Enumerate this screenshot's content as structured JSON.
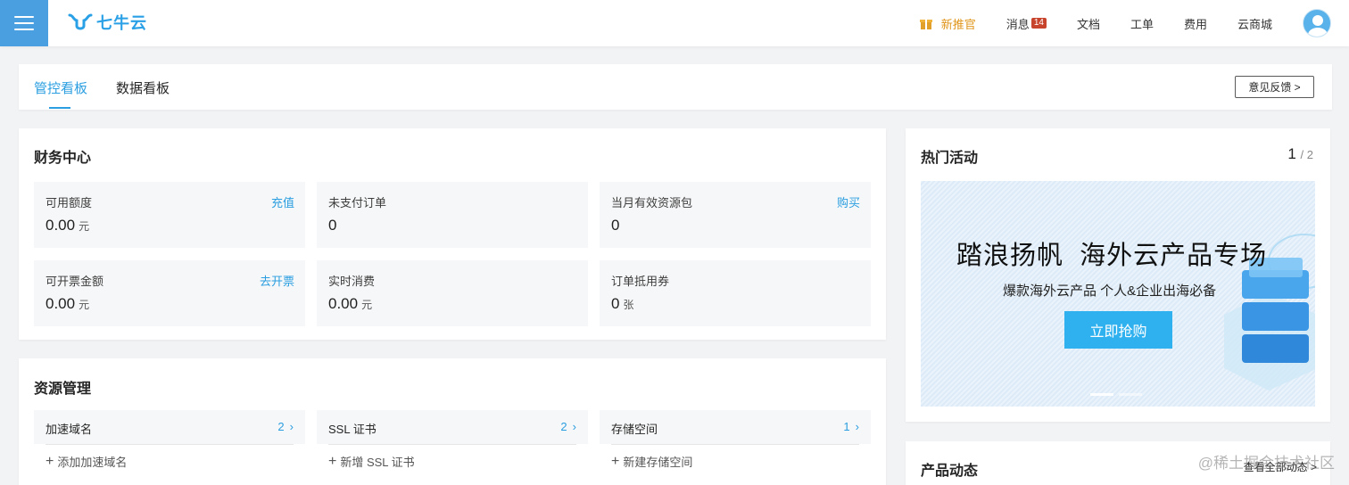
{
  "header": {
    "logo_text": "七牛云",
    "nav": {
      "promo": "新推官",
      "messages": "消息",
      "messages_count": "14",
      "docs": "文档",
      "tickets": "工单",
      "billing": "费用",
      "market": "云商城"
    }
  },
  "tabs": {
    "items": [
      "管控看板",
      "数据看板"
    ],
    "active_index": 0,
    "feedback": "意见反馈 >"
  },
  "finance": {
    "title": "财务中心",
    "cells": [
      {
        "label": "可用额度",
        "link": "充值",
        "value": "0.00",
        "unit": "元"
      },
      {
        "label": "未支付订单",
        "link": "",
        "value": "0",
        "unit": ""
      },
      {
        "label": "当月有效资源包",
        "link": "购买",
        "value": "0",
        "unit": ""
      },
      {
        "label": "可开票金额",
        "link": "去开票",
        "value": "0.00",
        "unit": "元"
      },
      {
        "label": "实时消费",
        "link": "",
        "value": "0.00",
        "unit": "元"
      },
      {
        "label": "订单抵用券",
        "link": "",
        "value": "0",
        "unit": "张"
      }
    ]
  },
  "resources": {
    "title": "资源管理",
    "cells": [
      {
        "name": "加速域名",
        "count": "2",
        "add": "添加加速域名"
      },
      {
        "name": "SSL 证书",
        "count": "2",
        "add": "新增 SSL 证书"
      },
      {
        "name": "存储空间",
        "count": "1",
        "add": "新建存储空间"
      }
    ]
  },
  "hot": {
    "title": "热门活动",
    "page_current": "1",
    "page_total": "/ 2",
    "banner": {
      "headline": "踏浪扬帆  海外云产品专场",
      "subline": "爆款海外云产品 个人&企业出海必备",
      "button": "立即抢购"
    }
  },
  "news": {
    "title": "产品动态",
    "see_all": "查看全部动态 >"
  },
  "watermark": "@稀土掘金技术社区",
  "colors": {
    "accent": "#2a9ee0",
    "menu_bg": "#4a9fe0",
    "promo": "#e0951a",
    "badge": "#c7432b",
    "banner_button": "#2fb1ef"
  }
}
